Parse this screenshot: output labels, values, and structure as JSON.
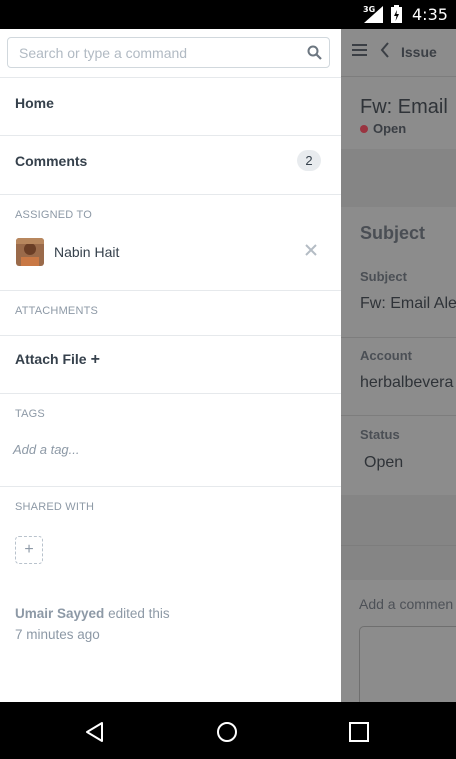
{
  "status_bar": {
    "network": "3G",
    "time": "4:35"
  },
  "background_app": {
    "breadcrumb": "Issue",
    "title": "Fw: Email",
    "status": "Open",
    "section_title": "Subject",
    "fields": [
      {
        "label": "Subject",
        "value": "Fw: Email Ale"
      },
      {
        "label": "Account",
        "value": "herbalbevera"
      },
      {
        "label": "Status",
        "value": "Open"
      }
    ],
    "comment_placeholder": "Add a commen"
  },
  "drawer": {
    "search_placeholder": "Search or type a command",
    "home_label": "Home",
    "comments_label": "Comments",
    "comments_count": "2",
    "assigned_heading": "ASSIGNED TO",
    "assignee_name": "Nabin Hait",
    "attachments_heading": "ATTACHMENTS",
    "attach_file_label": "Attach File",
    "tags_heading": "TAGS",
    "tag_placeholder": "Add a tag...",
    "shared_heading": "SHARED WITH",
    "activity_user": "Umair Sayyed",
    "activity_action": "edited this",
    "activity_time": "7 minutes ago"
  },
  "colors": {
    "status_open": "#9a3440",
    "drawer_text": "#36414c",
    "muted_text": "#8d99a6"
  }
}
